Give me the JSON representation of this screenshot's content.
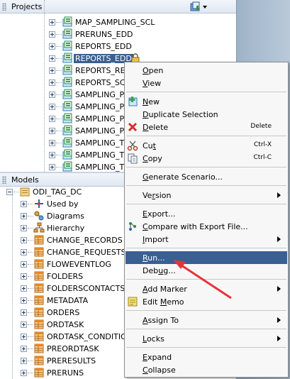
{
  "projects_pane": {
    "title": "Projects"
  },
  "models_pane": {
    "title": "Models"
  },
  "project_items": [
    {
      "label": "MAP_SAMPLING_SCL",
      "selected": false
    },
    {
      "label": "PRERUNS_EDD",
      "selected": false
    },
    {
      "label": "REPORTS_EDD",
      "selected": false
    },
    {
      "label": "REPORTS_EDD",
      "selected": true
    },
    {
      "label": "REPORTS_RE",
      "selected": false
    },
    {
      "label": "REPORTS_SC",
      "selected": false
    },
    {
      "label": "SAMPLING_PA",
      "selected": false
    },
    {
      "label": "SAMPLING_PA",
      "selected": false
    },
    {
      "label": "SAMPLING_PA",
      "selected": false
    },
    {
      "label": "SAMPLING_PA",
      "selected": false
    },
    {
      "label": "SAMPLING_T",
      "selected": false
    },
    {
      "label": "SAMPLING_T",
      "selected": false
    },
    {
      "label": "SAMPLING_T",
      "selected": false
    }
  ],
  "model_root": {
    "label": "ODI_TAG_DC"
  },
  "model_children": [
    {
      "label": "Used by",
      "icon": "used-by-icon"
    },
    {
      "label": "Diagrams",
      "icon": "diagrams-icon"
    },
    {
      "label": "Hierarchy",
      "icon": "hierarchy-icon"
    }
  ],
  "model_tables": [
    "CHANGE_RECORDS",
    "CHANGE_REQUESTS",
    "FLOWEVENTLOG",
    "FOLDERS",
    "FOLDERSCONTACTS",
    "METADATA",
    "ORDERS",
    "ORDTASK",
    "ORDTASK_CONDITIO",
    "PREORDTASK",
    "PRERESULTS",
    "PRERUNS"
  ],
  "context_menu": {
    "items": [
      {
        "label": "Open",
        "shortcut": "",
        "submenu": false,
        "icon": "",
        "highlight": false
      },
      {
        "label": "View",
        "shortcut": "",
        "submenu": false,
        "icon": "",
        "highlight": false
      },
      {
        "sep": true
      },
      {
        "label": "New",
        "shortcut": "",
        "submenu": false,
        "icon": "new-icon",
        "highlight": false
      },
      {
        "label": "Duplicate Selection",
        "shortcut": "",
        "submenu": false,
        "icon": "",
        "highlight": false
      },
      {
        "label": "Delete",
        "shortcut": "Delete",
        "submenu": false,
        "icon": "delete-icon",
        "highlight": false
      },
      {
        "sep": true
      },
      {
        "label": "Cut",
        "shortcut": "Ctrl-X",
        "submenu": false,
        "icon": "cut-icon",
        "highlight": false
      },
      {
        "label": "Copy",
        "shortcut": "Ctrl-C",
        "submenu": false,
        "icon": "copy-icon",
        "highlight": false
      },
      {
        "sep": true
      },
      {
        "label": "Generate Scenario...",
        "shortcut": "",
        "submenu": false,
        "icon": "",
        "highlight": false
      },
      {
        "sep": true
      },
      {
        "label": "Version",
        "shortcut": "",
        "submenu": true,
        "icon": "",
        "highlight": false
      },
      {
        "sep": true
      },
      {
        "label": "Export...",
        "shortcut": "",
        "submenu": false,
        "icon": "",
        "highlight": false
      },
      {
        "label": "Compare with Export File...",
        "shortcut": "",
        "submenu": false,
        "icon": "compare-icon",
        "highlight": false
      },
      {
        "label": "Import",
        "shortcut": "",
        "submenu": true,
        "icon": "",
        "highlight": false
      },
      {
        "sep": true
      },
      {
        "label": "Run...",
        "shortcut": "",
        "submenu": false,
        "icon": "",
        "highlight": true
      },
      {
        "label": "Debug...",
        "shortcut": "",
        "submenu": false,
        "icon": "",
        "highlight": false
      },
      {
        "sep": true
      },
      {
        "label": "Add Marker",
        "shortcut": "",
        "submenu": true,
        "icon": "",
        "highlight": false
      },
      {
        "label": "Edit Memo",
        "shortcut": "",
        "submenu": false,
        "icon": "memo-icon",
        "highlight": false
      },
      {
        "sep": true
      },
      {
        "label": "Assign To",
        "shortcut": "",
        "submenu": true,
        "icon": "",
        "highlight": false
      },
      {
        "sep": true
      },
      {
        "label": "Locks",
        "shortcut": "",
        "submenu": true,
        "icon": "",
        "highlight": false
      },
      {
        "sep": true
      },
      {
        "label": "Expand",
        "shortcut": "",
        "submenu": false,
        "icon": "",
        "highlight": false
      },
      {
        "label": "Collapse",
        "shortcut": "",
        "submenu": false,
        "icon": "",
        "highlight": false
      }
    ]
  },
  "colors": {
    "menu_highlight": "#3a5f92",
    "tree_selected": "#3c5f8e",
    "annotation_arrow": "#e8323a"
  }
}
